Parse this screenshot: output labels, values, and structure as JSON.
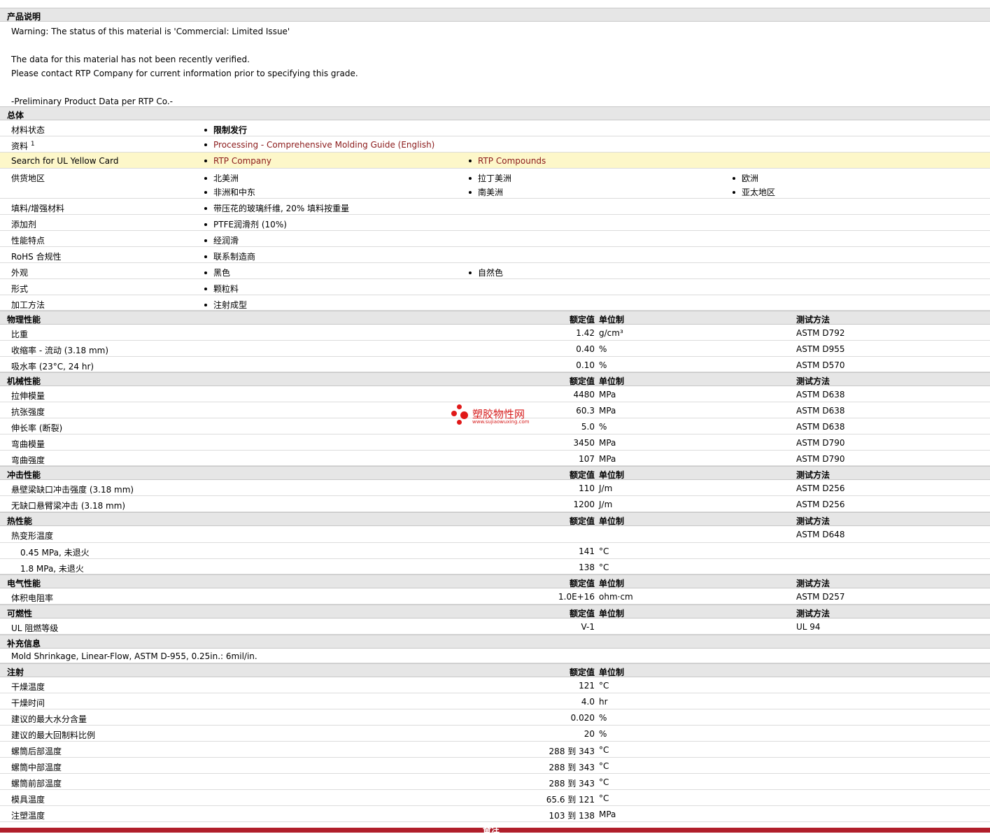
{
  "product_desc": {
    "header": "产品说明",
    "lines": [
      "Warning: The status of this material is 'Commercial: Limited Issue'",
      "",
      "The data for this material has not been recently verified.",
      "Please contact RTP Company for current information prior to specifying this grade.",
      "",
      "-Preliminary Product Data per RTP Co.-"
    ]
  },
  "general": {
    "header": "总体",
    "material_status": {
      "label": "材料状态",
      "value": "限制发行"
    },
    "docs": {
      "label": "资料",
      "sup": "1",
      "value": "Processing - Comprehensive Molding Guide (English)"
    },
    "ul": {
      "label": "Search for UL Yellow Card",
      "values": [
        "RTP Company",
        "RTP Compounds"
      ]
    },
    "supply": {
      "label": "供货地区",
      "values": [
        "北美洲",
        "拉丁美洲",
        "欧洲",
        "非洲和中东",
        "南美洲",
        "亚太地区"
      ]
    },
    "filler": {
      "label": "填料/增强材料",
      "value": "带压花的玻璃纤维, 20% 填料按重量"
    },
    "additive": {
      "label": "添加剂",
      "value": "PTFE润滑剂 (10%)"
    },
    "features": {
      "label": "性能特点",
      "value": "经润滑"
    },
    "rohs": {
      "label": "RoHS 合规性",
      "value": "联系制造商"
    },
    "appearance": {
      "label": "外观",
      "values": [
        "黑色",
        "自然色"
      ]
    },
    "form": {
      "label": "形式",
      "value": "颗粒料"
    },
    "process": {
      "label": "加工方法",
      "value": "注射成型"
    }
  },
  "col": {
    "value": "额定值",
    "unit": "单位制",
    "method": "测试方法"
  },
  "physical": {
    "header": "物理性能",
    "rows": [
      {
        "label": "比重",
        "value": "1.42",
        "unit": "g/cm³",
        "method": "ASTM D792"
      },
      {
        "label": "收缩率  - 流动  (3.18 mm)",
        "value": "0.40",
        "unit": "%",
        "method": "ASTM D955"
      },
      {
        "label": "吸水率  (23°C, 24 hr)",
        "value": "0.10",
        "unit": "%",
        "method": "ASTM D570"
      }
    ]
  },
  "mechanical": {
    "header": "机械性能",
    "rows": [
      {
        "label": "拉伸模量",
        "value": "4480",
        "unit": "MPa",
        "method": "ASTM D638"
      },
      {
        "label": "抗张强度",
        "value": "60.3",
        "unit": "MPa",
        "method": "ASTM D638"
      },
      {
        "label": "伸长率  (断裂)",
        "value": "5.0",
        "unit": "%",
        "method": "ASTM D638"
      },
      {
        "label": "弯曲模量",
        "value": "3450",
        "unit": "MPa",
        "method": "ASTM D790"
      },
      {
        "label": "弯曲强度",
        "value": "107",
        "unit": "MPa",
        "method": "ASTM D790"
      }
    ]
  },
  "impact": {
    "header": "冲击性能",
    "rows": [
      {
        "label": "悬壁梁缺口冲击强度  (3.18 mm)",
        "value": "110",
        "unit": "J/m",
        "method": "ASTM D256"
      },
      {
        "label": "无缺口悬臂梁冲击  (3.18 mm)",
        "value": "1200",
        "unit": "J/m",
        "method": "ASTM D256"
      }
    ]
  },
  "thermal": {
    "header": "热性能",
    "hdt": {
      "label": "热变形温度",
      "method": "ASTM D648"
    },
    "rows": [
      {
        "label": "0.45 MPa, 未退火",
        "value": "141",
        "unit": "°C"
      },
      {
        "label": "1.8 MPa, 未退火",
        "value": "138",
        "unit": "°C"
      }
    ]
  },
  "electrical": {
    "header": "电气性能",
    "rows": [
      {
        "label": "体积电阻率",
        "value": "1.0E+16",
        "unit": "ohm·cm",
        "method": "ASTM D257"
      }
    ]
  },
  "flammability": {
    "header": "可燃性",
    "rows": [
      {
        "label": "UL 阻燃等级",
        "value": "V-1",
        "unit": "",
        "method": "UL 94"
      }
    ]
  },
  "supplement": {
    "header": "补充信息",
    "text": "Mold Shrinkage, Linear-Flow, ASTM D-955, 0.25in.: 6mil/in."
  },
  "injection": {
    "header": "注射",
    "rows": [
      {
        "label": "干燥温度",
        "value": "121",
        "unit": "°C"
      },
      {
        "label": "干燥时间",
        "value": "4.0",
        "unit": "hr"
      },
      {
        "label": "建议的最大水分含量",
        "value": "0.020",
        "unit": "%"
      },
      {
        "label": "建议的最大回制料比例",
        "value": "20",
        "unit": "%"
      },
      {
        "label": "螺筒后部温度",
        "value": "288 到  343",
        "unit": "°C"
      },
      {
        "label": "螺筒中部温度",
        "value": "288 到  343",
        "unit": "°C"
      },
      {
        "label": "螺筒前部温度",
        "value": "288 到  343",
        "unit": "°C"
      },
      {
        "label": "模具温度",
        "value": "65.6 到  121",
        "unit": "°C"
      },
      {
        "label": "注塑温度",
        "value": "103 到  138",
        "unit": "MPa"
      }
    ]
  },
  "footer": {
    "text": "备注"
  },
  "watermark": {
    "text": "塑胶物性网",
    "url": "www.sujiaowuxing.com"
  }
}
